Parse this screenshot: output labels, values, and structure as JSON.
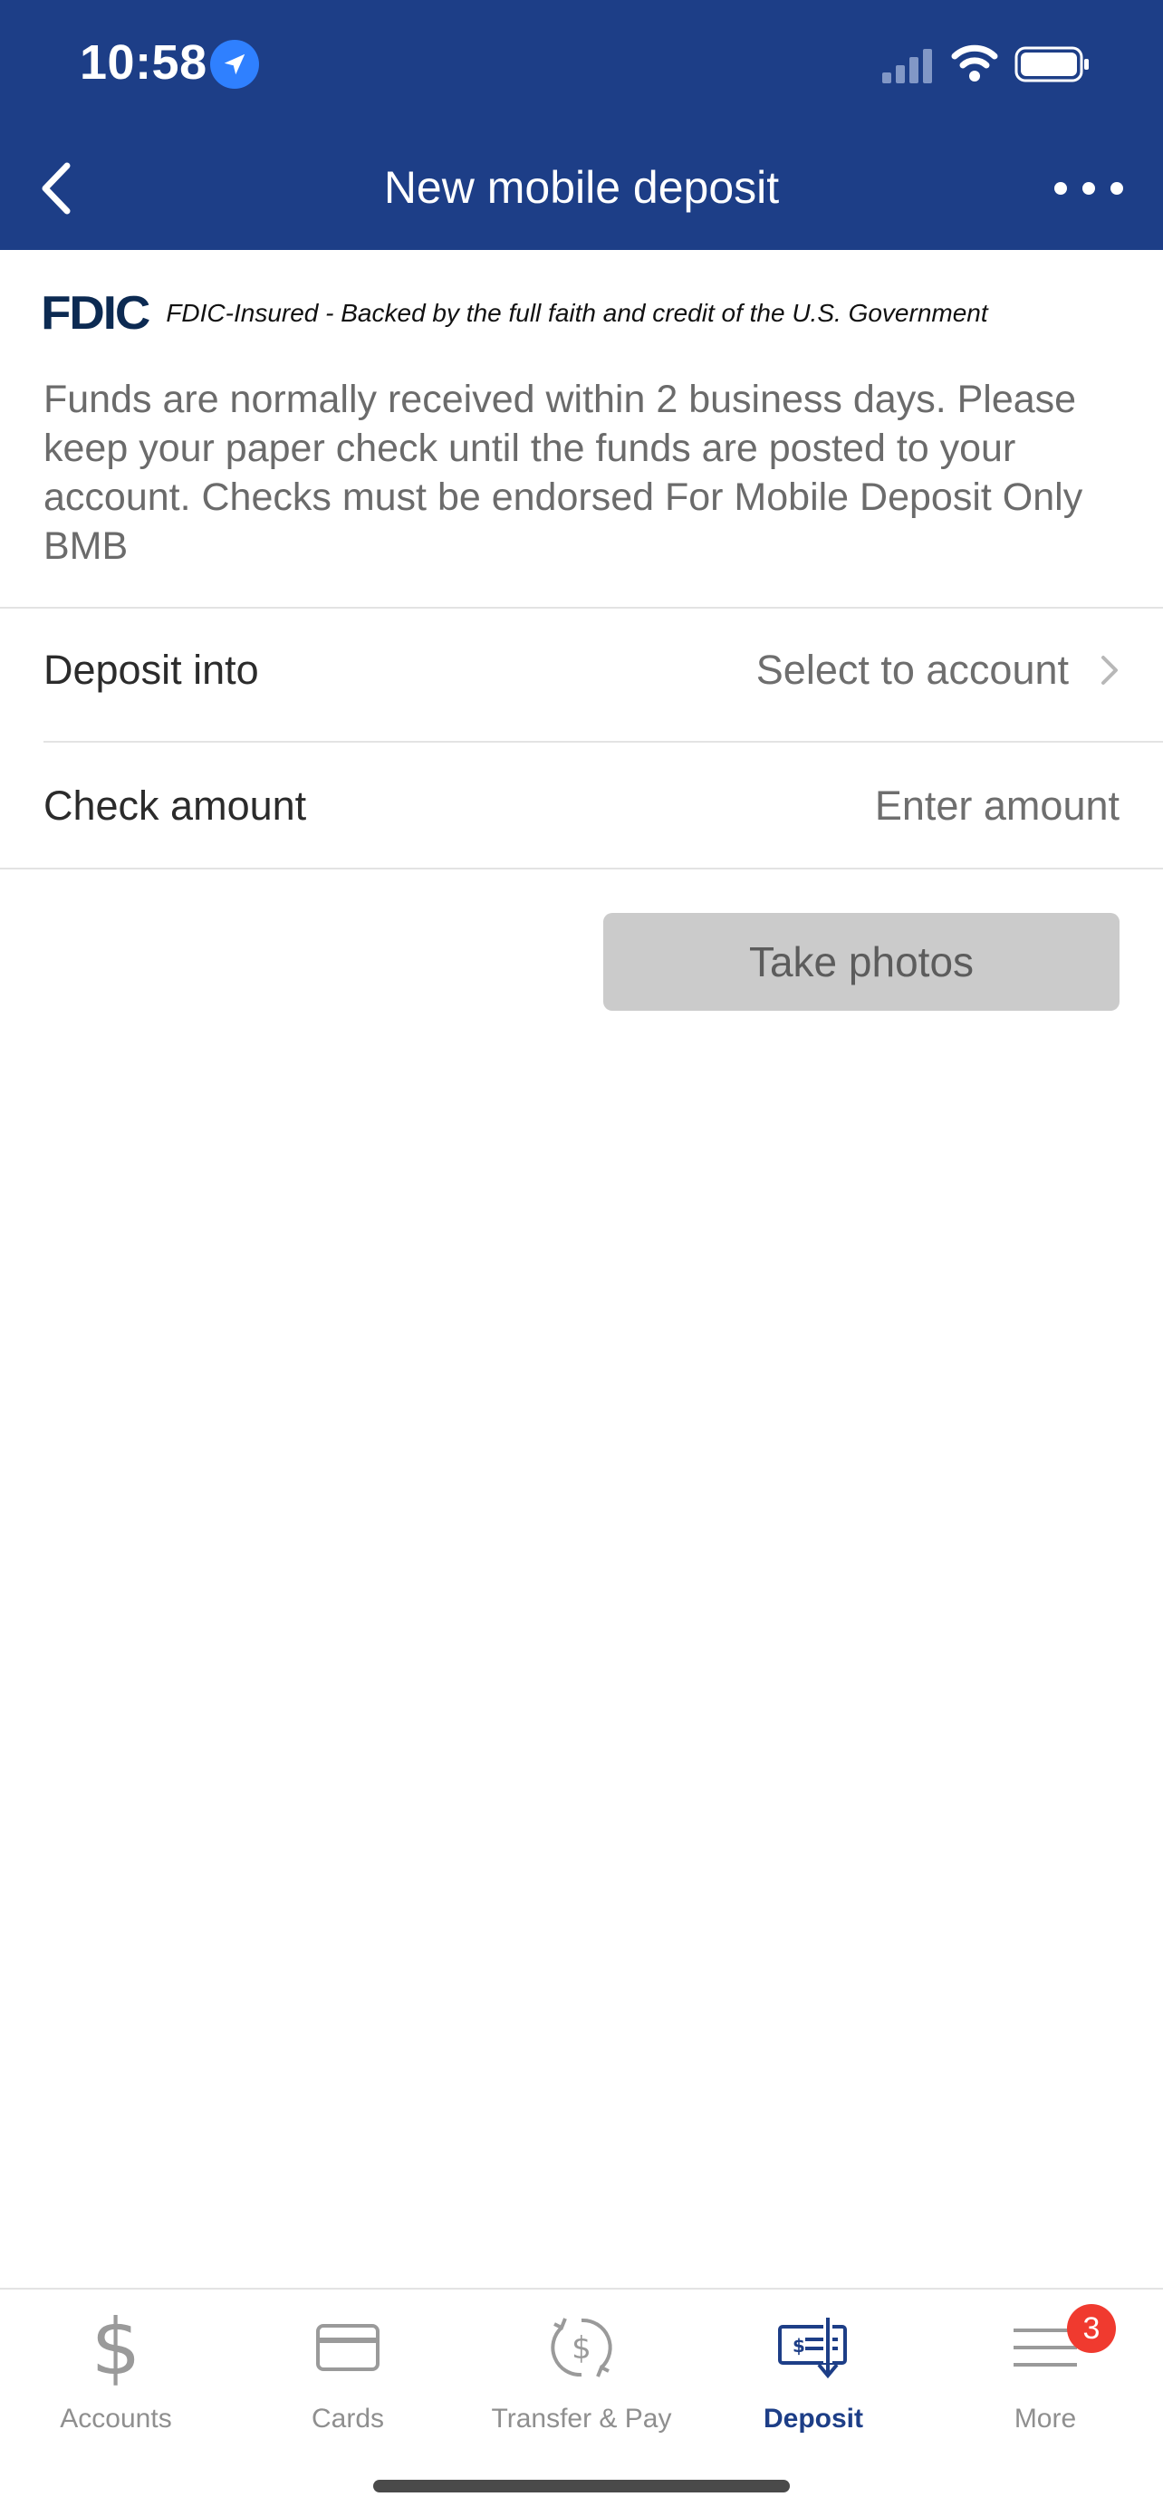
{
  "status_bar": {
    "time": "10:58"
  },
  "nav": {
    "title": "New mobile deposit"
  },
  "fdic": {
    "logo": "FDIC",
    "text": "FDIC-Insured - Backed by the full faith and credit of the U.S. Government"
  },
  "info": {
    "text": "Funds are normally received within 2 business days. Please keep your paper check until the funds are posted to your account. Checks must be endorsed For Mobile Deposit Only BMB"
  },
  "form": {
    "deposit_into_label": "Deposit into",
    "deposit_into_value": "Select to account",
    "check_amount_label": "Check amount",
    "check_amount_placeholder": "Enter amount"
  },
  "actions": {
    "take_photos": "Take photos"
  },
  "tabs": [
    {
      "label": "Accounts",
      "icon": "dollar-icon"
    },
    {
      "label": "Cards",
      "icon": "card-icon"
    },
    {
      "label": "Transfer & Pay",
      "icon": "transfer-icon"
    },
    {
      "label": "Deposit",
      "icon": "check-deposit-icon",
      "active": true
    },
    {
      "label": "More",
      "icon": "menu-icon",
      "badge": "3"
    }
  ],
  "colors": {
    "header": "#1d3e87",
    "active_tab": "#1d3e87",
    "badge": "#f03a2f",
    "disabled_button": "#cbcbcb"
  }
}
